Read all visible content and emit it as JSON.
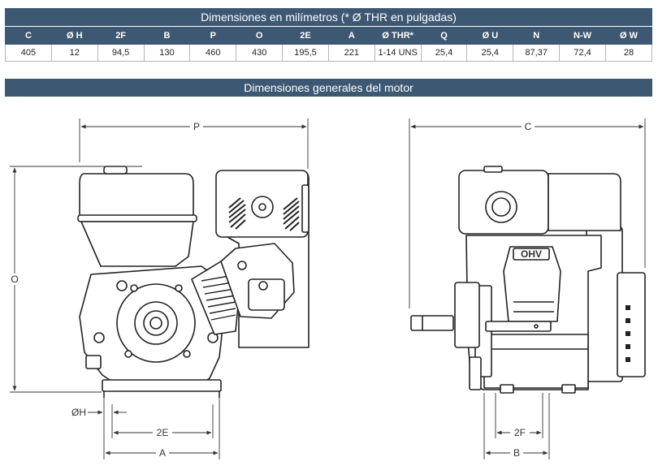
{
  "title": "Dimensiones en milímetros (* Ø THR en pulgadas)",
  "table": {
    "headers": [
      "C",
      "Ø H",
      "2F",
      "B",
      "P",
      "O",
      "2E",
      "A",
      "Ø THR*",
      "Q",
      "Ø U",
      "N",
      "N-W",
      "Ø W"
    ],
    "values": [
      "405",
      "12",
      "94,5",
      "130",
      "460",
      "430",
      "195,5",
      "221",
      "1-14 UNS",
      "25,4",
      "25,4",
      "87,37",
      "72,4",
      "28"
    ]
  },
  "engine_section_title": "Dimensiones generales del motor",
  "drawing_labels": {
    "p": "P",
    "o": "O",
    "oh": "ØH",
    "two_e": "2E",
    "a": "A",
    "c": "C",
    "two_f": "2F",
    "b": "B",
    "ohv": "OHV"
  }
}
